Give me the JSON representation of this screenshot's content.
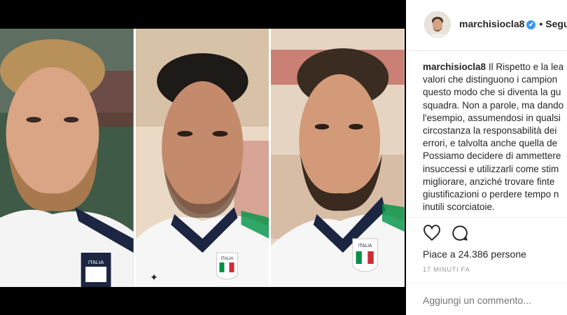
{
  "post": {
    "username": "marchisiocla8",
    "verified_symbol": "✔",
    "dot": "•",
    "follow_label": "Segui",
    "caption_lines": [
      "Il Rispetto e la lea",
      "valori che distinguono i campion",
      "questo modo che si diventa la gu",
      "squadra. Non a parole, ma dando",
      "l'esempio, assumendosi in qualsi",
      "circostanza la responsabilità dei",
      "errori, e talvolta anche quella de",
      "Possiamo decidere di ammettere",
      "insuccessi e utilizzarli come stim",
      "migliorare, anziché trovare finte",
      "giustificazioni o perdere tempo n",
      "inutili scorciatoie."
    ],
    "likes_text": "Piace a 24.386 persone",
    "timestamp": "17 MINUTI FA",
    "comment_placeholder": "Aggiungi un commento..."
  },
  "photo": {
    "badge_text": "ITALIA",
    "colors": {
      "green": "#009246",
      "white": "#ffffff",
      "red": "#ce2b37",
      "navy": "#1c2541"
    }
  },
  "icons": [
    "heart-icon",
    "comment-icon",
    "verified-icon"
  ]
}
